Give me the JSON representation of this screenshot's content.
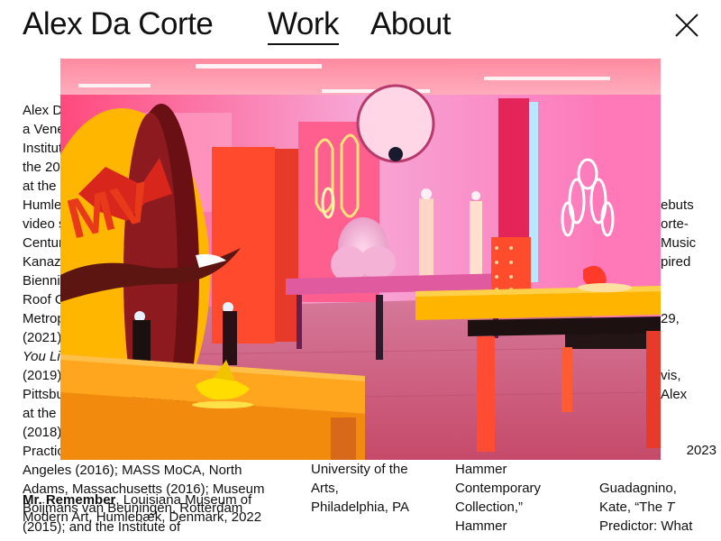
{
  "header": {
    "site_title": "Alex Da Corte",
    "nav": [
      {
        "label": "Work",
        "active": true
      },
      {
        "label": "About",
        "active": false
      }
    ],
    "close_icon": "close-x-icon"
  },
  "bio_column": {
    "lines": [
      "Alex D",
      "a Vene",
      "Institut",
      "the 20",
      "at the",
      "Humle",
      "video s",
      "Centur",
      "Kanaz",
      "Bienni",
      "Roof G",
      "Metrop",
      "(2021)",
      "You Li",
      "(2019)",
      "Pittsbu",
      "at the",
      "(2018)",
      "Practic",
      "Angeles (2016); MASS MoCA, North",
      "Adams, Massachusetts (2016); Museum",
      "Boijmans van Beuningen, Rotterdam",
      "(2015); and the Institute of"
    ],
    "italic_line_index": 13,
    "overlap_text": {
      "bold": "Mr. Remember",
      "rest": ", Louisiana Museum of Modern Art, Humlebæk, Denmark, 2022"
    }
  },
  "right_edge_fragments": [
    "ebuts",
    "orte-",
    "Music",
    "pired",
    "29,",
    "vis,",
    "Alex"
  ],
  "col2": {
    "lines": [
      "University of the",
      "Arts,",
      "Philadelphia, PA"
    ]
  },
  "col3": {
    "lines": [
      "Hammer",
      "Contemporary",
      "Collection,”",
      "Hammer"
    ]
  },
  "col4": {
    "lines": [
      "2023",
      "Guadagnino,",
      "Kate, “The T",
      "Predictor: What"
    ],
    "italic_fragment": "T"
  },
  "colors": {
    "background": "#ffffff",
    "text": "#111111",
    "image_pink": "#ff5fa8",
    "image_yellow": "#ffb400",
    "image_red": "#e83a2a"
  },
  "image": {
    "alt_icon": "gallery-installation-photo"
  }
}
